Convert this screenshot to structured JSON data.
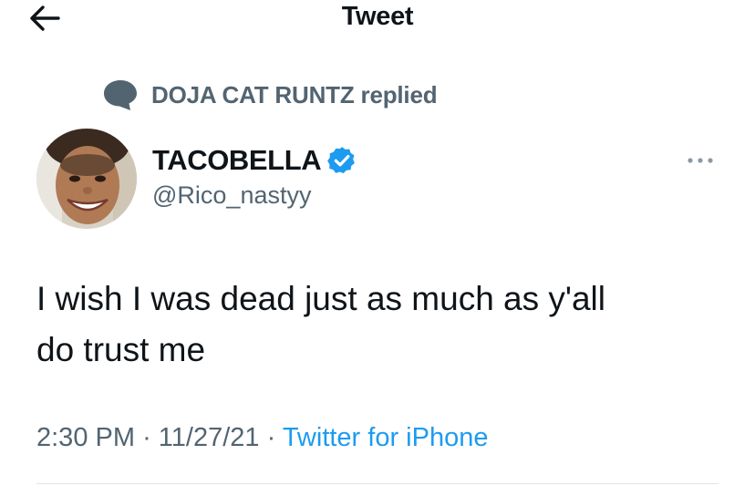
{
  "header": {
    "title": "Tweet",
    "back_icon": "arrow-left-icon"
  },
  "social_context": {
    "icon": "speech-bubble-icon",
    "text": "DOJA CAT RUNTZ replied"
  },
  "author": {
    "name": "TACOBELLA",
    "handle": "@Rico_nastyy",
    "verified": true,
    "verified_icon": "verified-badge-icon"
  },
  "more_icon": "more-dots-icon",
  "tweet": {
    "text": "I wish I was dead just as much as y'all\ndo trust me"
  },
  "meta": {
    "time": "2:30 PM",
    "separator": "·",
    "date": "11/27/21",
    "source": "Twitter for iPhone"
  },
  "colors": {
    "primary_text": "#0f1419",
    "secondary_text": "#536471",
    "accent": "#1d9bf0",
    "divider": "#e1e6ea"
  }
}
